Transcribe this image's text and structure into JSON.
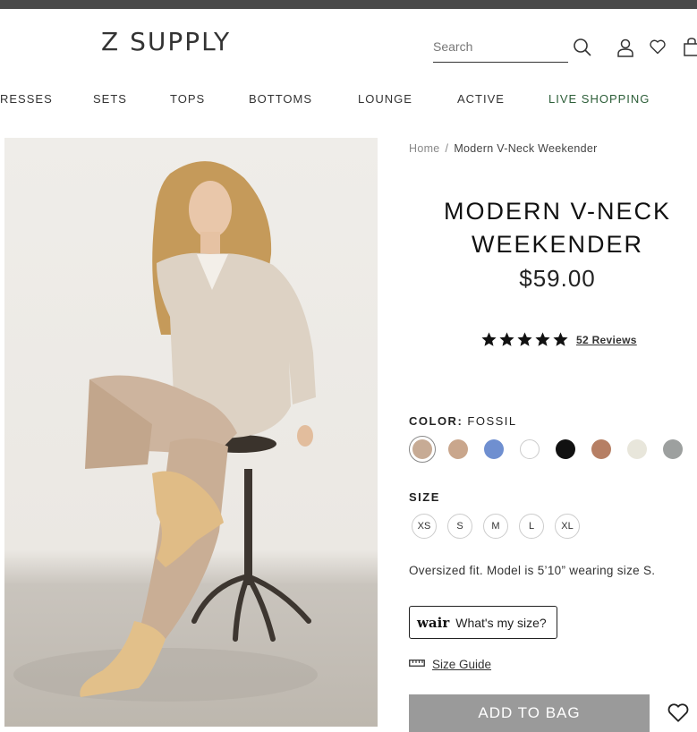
{
  "header": {
    "logo": "Z SUPPLY",
    "search_placeholder": "Search"
  },
  "nav": {
    "items": [
      "RESSES",
      "SETS",
      "TOPS",
      "BOTTOMS",
      "LOUNGE",
      "ACTIVE",
      "LIVE SHOPPING"
    ]
  },
  "breadcrumb": {
    "home": "Home",
    "separator": "/",
    "current": "Modern V-Neck Weekender"
  },
  "product": {
    "title_line1": "MODERN V-NECK",
    "title_line2": "WEEKENDER",
    "price": "$59.00",
    "rating_stars": 5,
    "reviews_label": "52 Reviews",
    "color_label": "COLOR:",
    "color_value": "FOSSIL",
    "swatch_colors": [
      "#c7ab95",
      "#c9a68c",
      "#6f8fd0",
      "#ffffff",
      "#111111",
      "#b67f64",
      "#e8e6db",
      "#9da09f"
    ],
    "size_label": "SIZE",
    "sizes": [
      "XS",
      "S",
      "M",
      "L",
      "XL"
    ],
    "fit_note": "Oversized fit. Model is 5’10” wearing size S.",
    "wair_logo": "wair",
    "wair_text": "What's my size?",
    "size_guide": "Size Guide",
    "add_to_bag": "ADD TO BAG"
  },
  "colors": {
    "topbar": "#4a4a4a",
    "live_shopping": "#2c5e38",
    "add_to_bag_bg": "#9a9a9a"
  }
}
